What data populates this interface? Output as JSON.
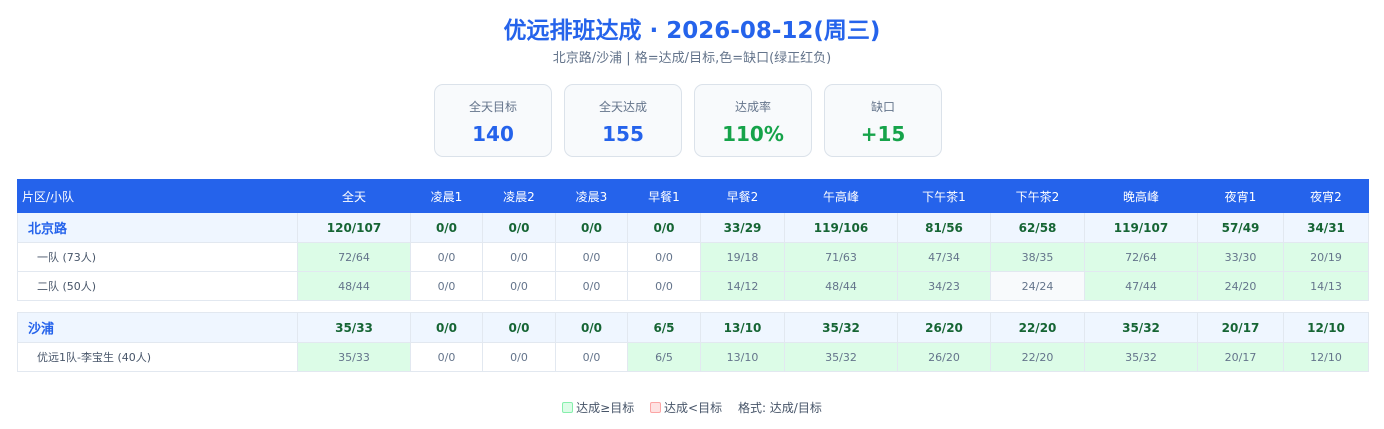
{
  "header": {
    "title": "优远排班达成 · 2026-08-12(周三)",
    "subtitle": "北京路/沙浦 | 格=达成/目标,色=缺口(绿正红负)"
  },
  "cards": [
    {
      "label": "全天目标",
      "value": "140",
      "color": "#2563eb"
    },
    {
      "label": "全天达成",
      "value": "155",
      "color": "#2563eb"
    },
    {
      "label": "达成率",
      "value": "110%",
      "color": "#16a34a"
    },
    {
      "label": "缺口",
      "value": "+15",
      "color": "#16a34a"
    }
  ],
  "table": {
    "columns": [
      "片区/小队",
      "全天",
      "凌晨1",
      "凌晨2",
      "凌晨3",
      "早餐1",
      "早餐2",
      "午高峰",
      "下午茶1",
      "下午茶2",
      "晚高峰",
      "夜宵1",
      "夜宵2"
    ],
    "groups": [
      {
        "region": {
          "name": "北京路",
          "cells": [
            "120/107",
            "0/0",
            "0/0",
            "0/0",
            "0/0",
            "33/29",
            "119/106",
            "81/56",
            "62/58",
            "119/107",
            "57/49",
            "34/31"
          ]
        },
        "teams": [
          {
            "name": "一队 (73人)",
            "cells": [
              "72/64",
              "0/0",
              "0/0",
              "0/0",
              "0/0",
              "19/18",
              "71/63",
              "47/34",
              "38/35",
              "72/64",
              "33/30",
              "20/19"
            ]
          },
          {
            "name": "二队 (50人)",
            "cells": [
              "48/44",
              "0/0",
              "0/0",
              "0/0",
              "0/0",
              "14/12",
              "48/44",
              "34/23",
              "24/24",
              "47/44",
              "24/20",
              "14/13"
            ]
          }
        ]
      },
      {
        "region": {
          "name": "沙浦",
          "cells": [
            "35/33",
            "0/0",
            "0/0",
            "0/0",
            "6/5",
            "13/10",
            "35/32",
            "26/20",
            "22/20",
            "35/32",
            "20/17",
            "12/10"
          ]
        },
        "teams": [
          {
            "name": "优远1队-李宝生 (40人)",
            "cells": [
              "35/33",
              "0/0",
              "0/0",
              "0/0",
              "6/5",
              "13/10",
              "35/32",
              "26/20",
              "22/20",
              "35/32",
              "20/17",
              "12/10"
            ]
          }
        ]
      }
    ]
  },
  "legend": {
    "ok": "达成≥目标",
    "bad": "达成<目标",
    "format": "格式: 达成/目标"
  }
}
